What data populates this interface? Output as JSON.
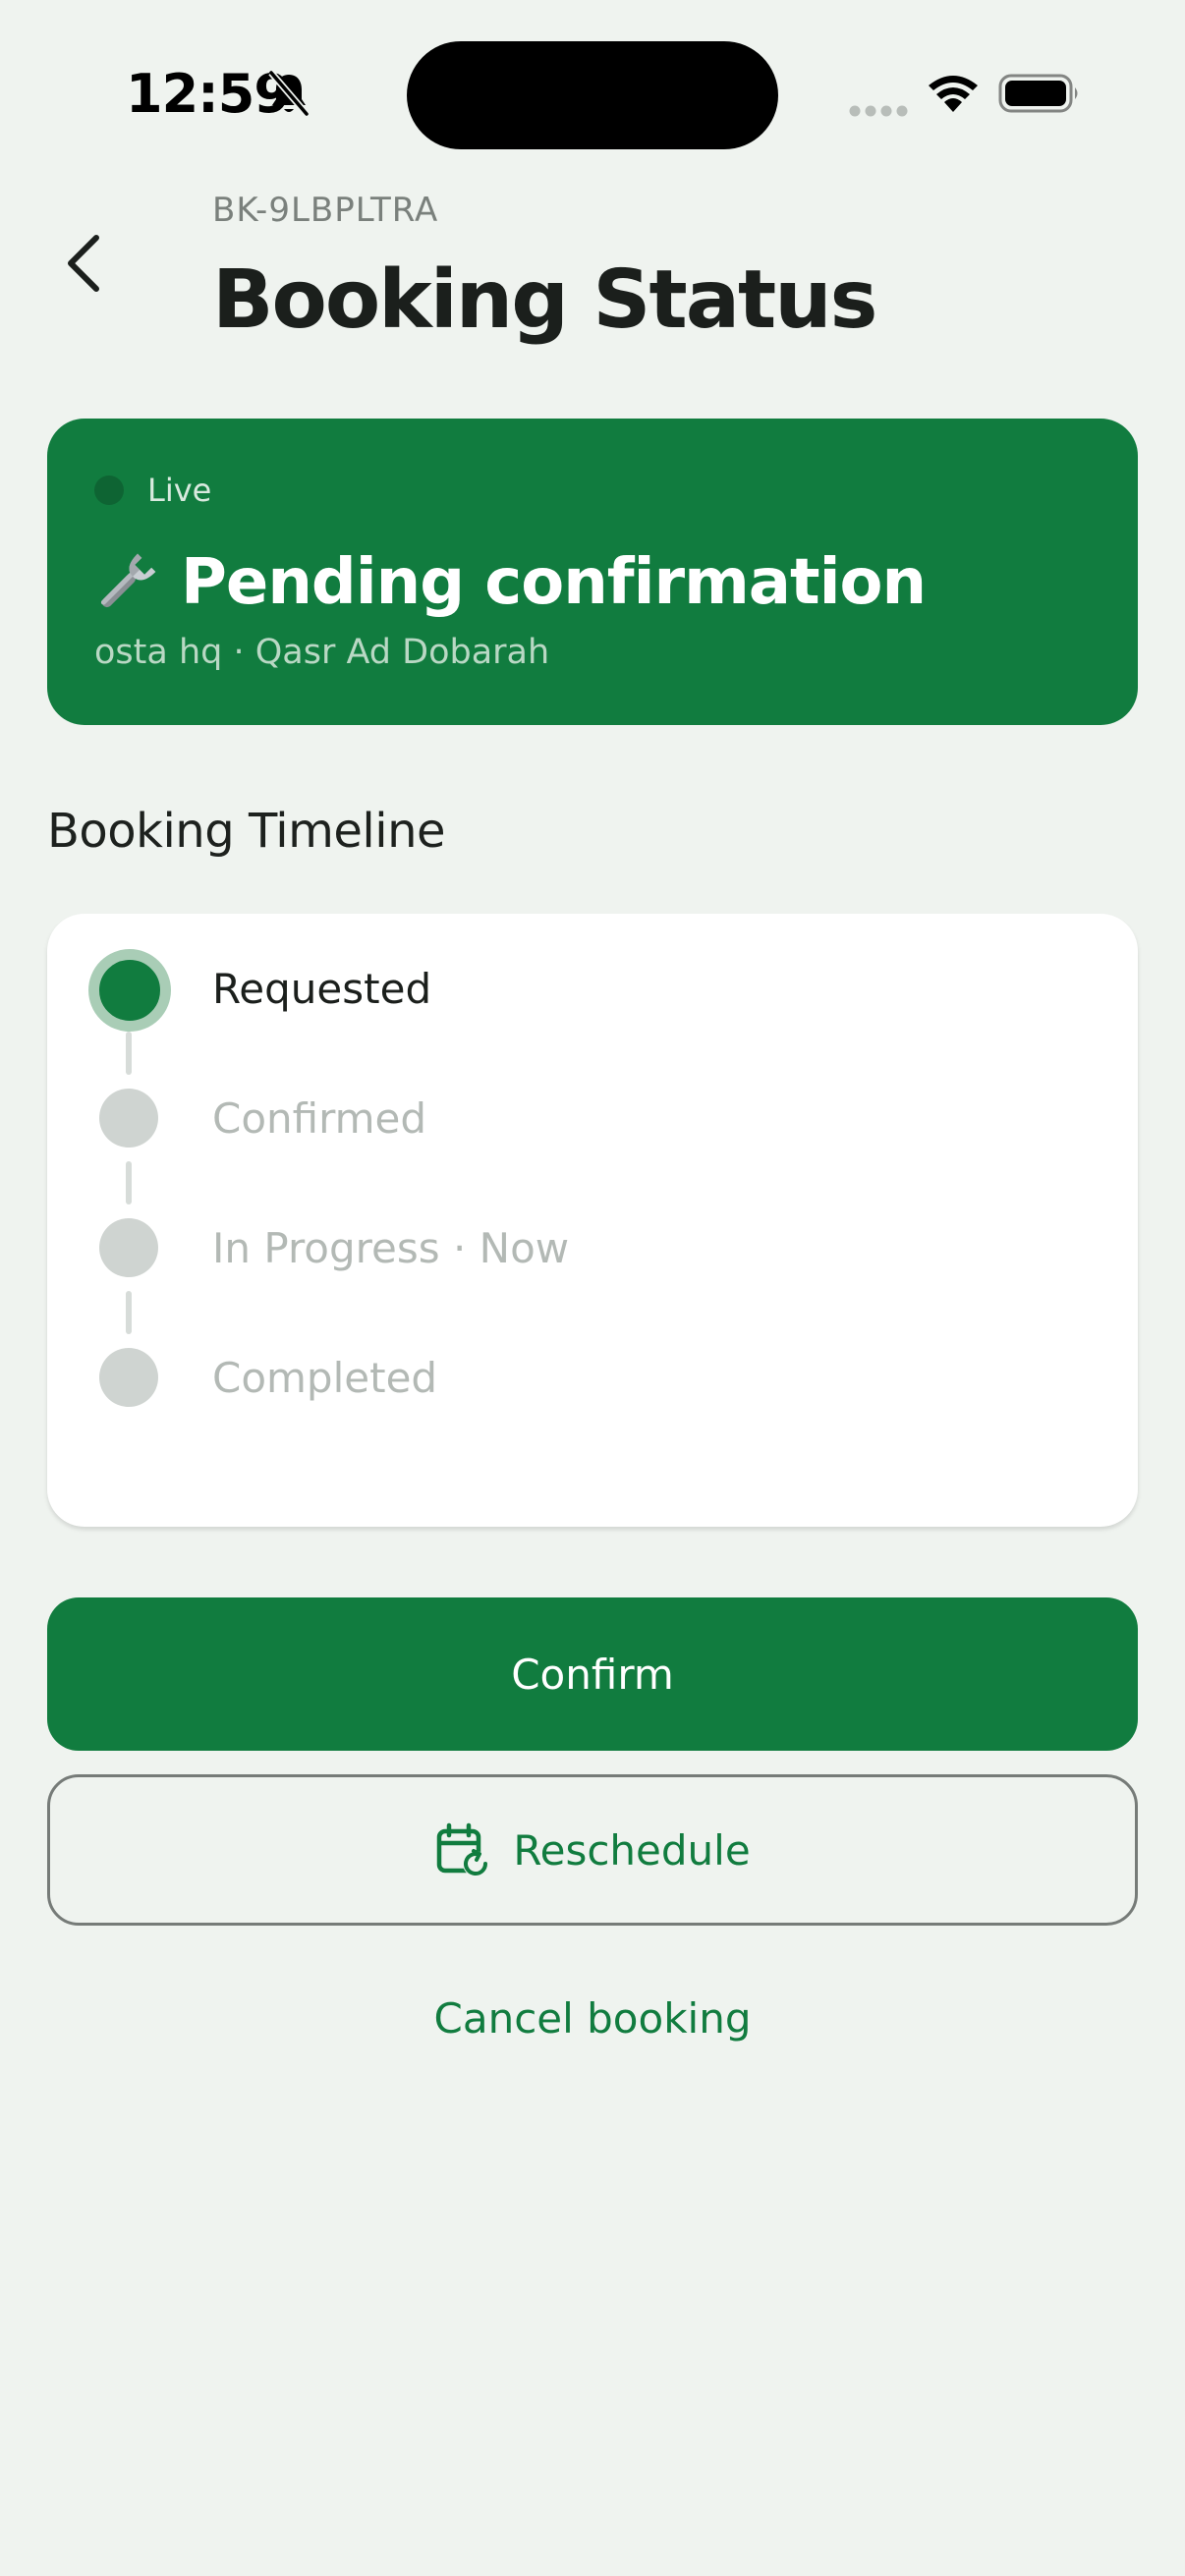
{
  "status_bar": {
    "time": "12:59",
    "icons": [
      "bell-muted-icon",
      "signal-icon",
      "wifi-icon",
      "battery-icon"
    ]
  },
  "header": {
    "booking_ref": "BK-9LBPLTRA",
    "title": "Booking Status",
    "back_icon": "chevron-left-icon"
  },
  "status_card": {
    "live_label": "Live",
    "icon": "wrench-icon",
    "title": "Pending confirmation",
    "subtitle": "osta hq · Qasr Ad Dobarah",
    "background_color": "#117c3f"
  },
  "timeline": {
    "title": "Booking Timeline",
    "steps": [
      {
        "label": "Requested",
        "state": "active"
      },
      {
        "label": "Confirmed",
        "state": "pending"
      },
      {
        "label": "In Progress · Now",
        "state": "pending"
      },
      {
        "label": "Completed",
        "state": "pending"
      }
    ]
  },
  "actions": {
    "confirm_label": "Confirm",
    "reschedule_label": "Reschedule",
    "reschedule_icon": "calendar-reschedule-icon",
    "cancel_label": "Cancel booking"
  },
  "colors": {
    "primary": "#117c3f",
    "background": "#eff3ef",
    "inactive": "#cfd4d1"
  }
}
